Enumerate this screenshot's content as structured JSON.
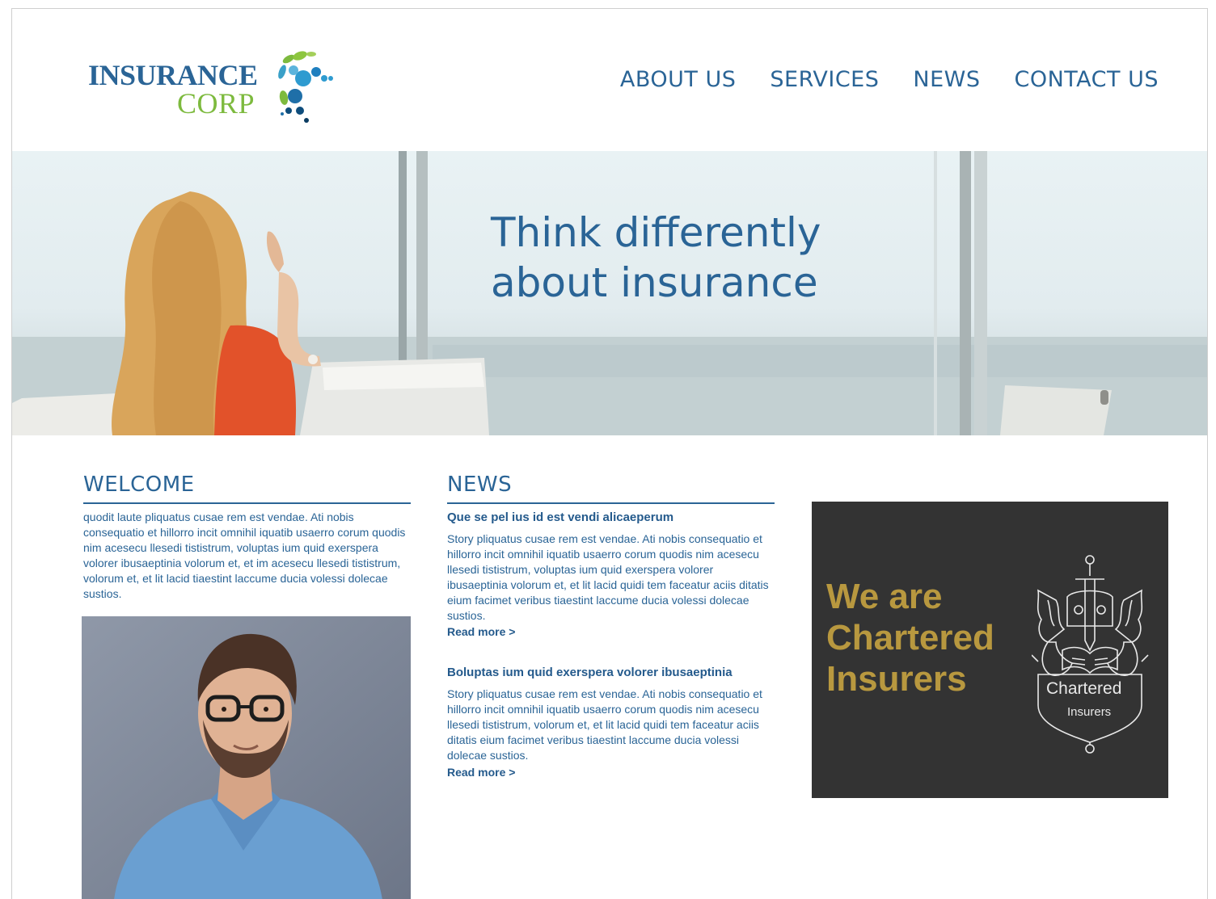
{
  "brand": {
    "line1": "INSURANCE",
    "line2": "CORP",
    "colors": {
      "blue": "#2a6496",
      "green": "#7dba3e",
      "gold": "#b8983f",
      "dark": "#333333"
    }
  },
  "nav": {
    "items": [
      "ABOUT US",
      "SERVICES",
      "NEWS",
      "CONTACT US"
    ]
  },
  "hero": {
    "line1": "Think differently",
    "line2": "about insurance"
  },
  "welcome": {
    "heading": "WELCOME",
    "text": "quodit laute pliquatus cusae rem est vendae. Ati nobis consequatio et hillorro incit omnihil iquatib usaerro corum quodis nim acesecu llesedi tististrum, voluptas ium quid exerspera volorer ibusaeptinia volorum et, et im acesecu llesedi tististrum, volorum et, et lit lacid tiaestint laccume ducia volessi dolecae sustios."
  },
  "news": {
    "heading": "NEWS",
    "items": [
      {
        "title": "Que se pel ius id est vendi alicaeperum",
        "text": "Story pliquatus cusae rem est vendae. Ati nobis consequatio et hillorro incit omnihil iquatib usaerro corum quodis nim acesecu llesedi tististrum, voluptas ium quid exerspera volorer ibusaeptinia volorum et, et lit lacid quidi tem faceatur aciis ditatis eium facimet veribus tiaestint laccume ducia volessi dolecae sustios.",
        "more": "Read more >"
      },
      {
        "title": "Boluptas ium quid exerspera volorer ibusaeptinia",
        "text": "Story pliquatus cusae rem est vendae. Ati nobis consequatio et hillorro incit omnihil iquatib usaerro corum quodis nim acesecu llesedi tististrum, volorum et, et lit lacid quidi tem faceatur aciis ditatis eium facimet veribus tiaestint laccume ducia volessi dolecae sustios.",
        "more": "Read more >"
      }
    ]
  },
  "badge": {
    "line1": "We are",
    "line2": "Chartered",
    "line3": "Insurers",
    "crest_label1": "Chartered",
    "crest_label2": "Insurers",
    "crest_icon": "heraldic-crest-icon"
  }
}
